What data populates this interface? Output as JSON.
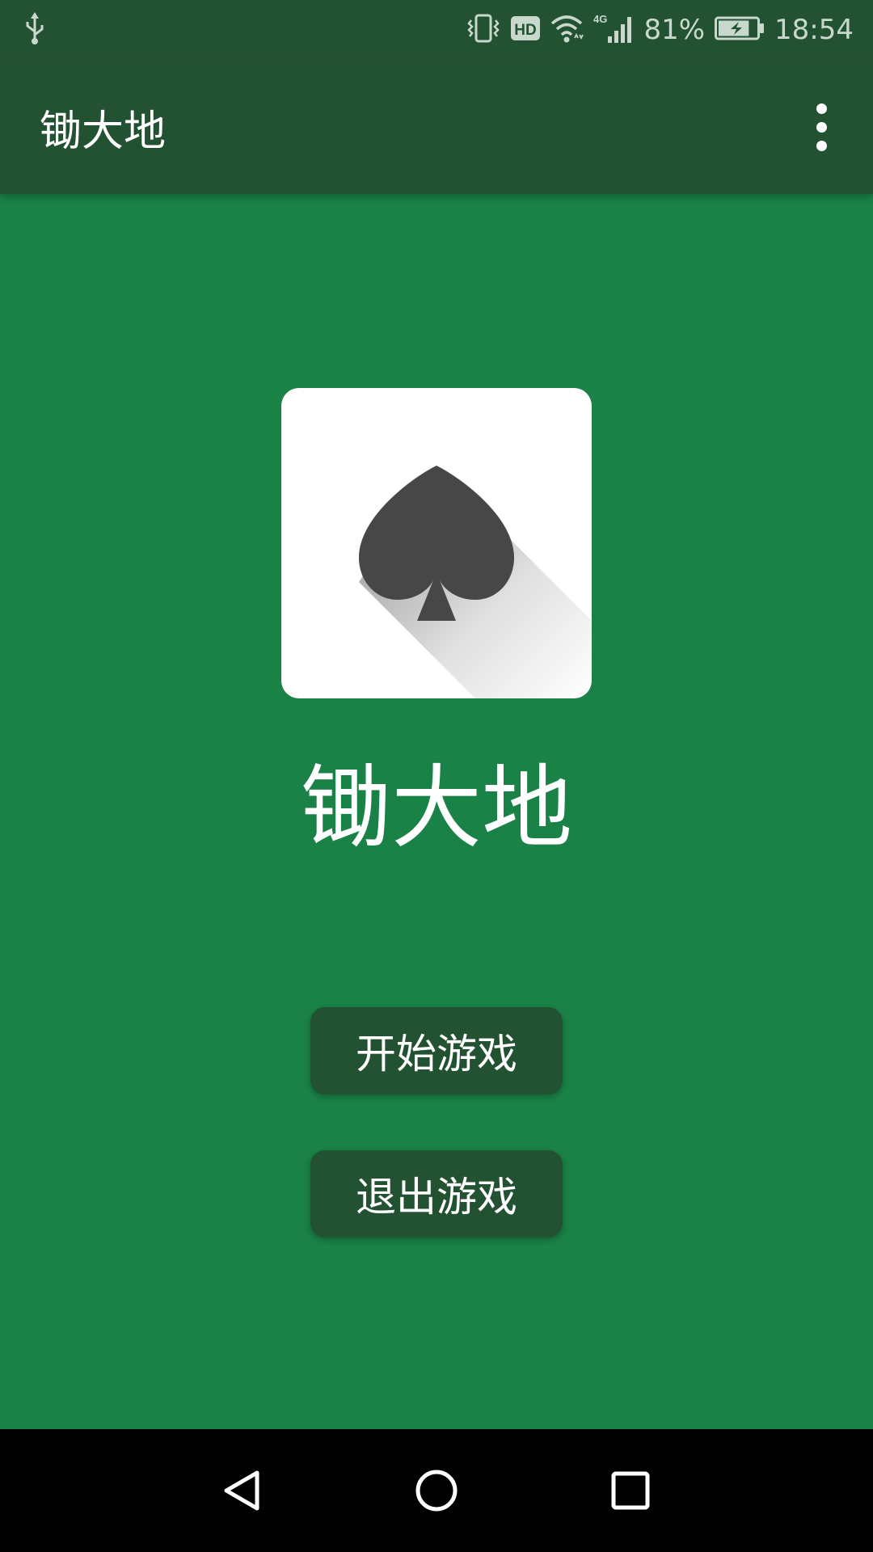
{
  "status_bar": {
    "usb_icon": "usb-icon",
    "icons": [
      "vibrate-icon",
      "hd-icon",
      "wifi-icon",
      "4g-signal-icon",
      "battery-charging-icon"
    ],
    "hd_label": "HD",
    "network_label": "4G",
    "battery_percent": "81%",
    "battery_level": 0.81,
    "time": "18:54"
  },
  "app_bar": {
    "title": "锄大地",
    "overflow_icon": "more-vert-icon"
  },
  "logo": {
    "icon": "spade-icon"
  },
  "main": {
    "game_title": "锄大地",
    "start_button_label": "开始游戏",
    "exit_button_label": "退出游戏"
  },
  "nav_bar": {
    "back_icon": "back-triangle-icon",
    "home_icon": "home-circle-icon",
    "recents_icon": "recents-square-icon"
  },
  "colors": {
    "background": "#1a8247",
    "app_bar": "#235232",
    "button": "#235232",
    "spade": "#474747",
    "nav_bar": "#000000"
  }
}
